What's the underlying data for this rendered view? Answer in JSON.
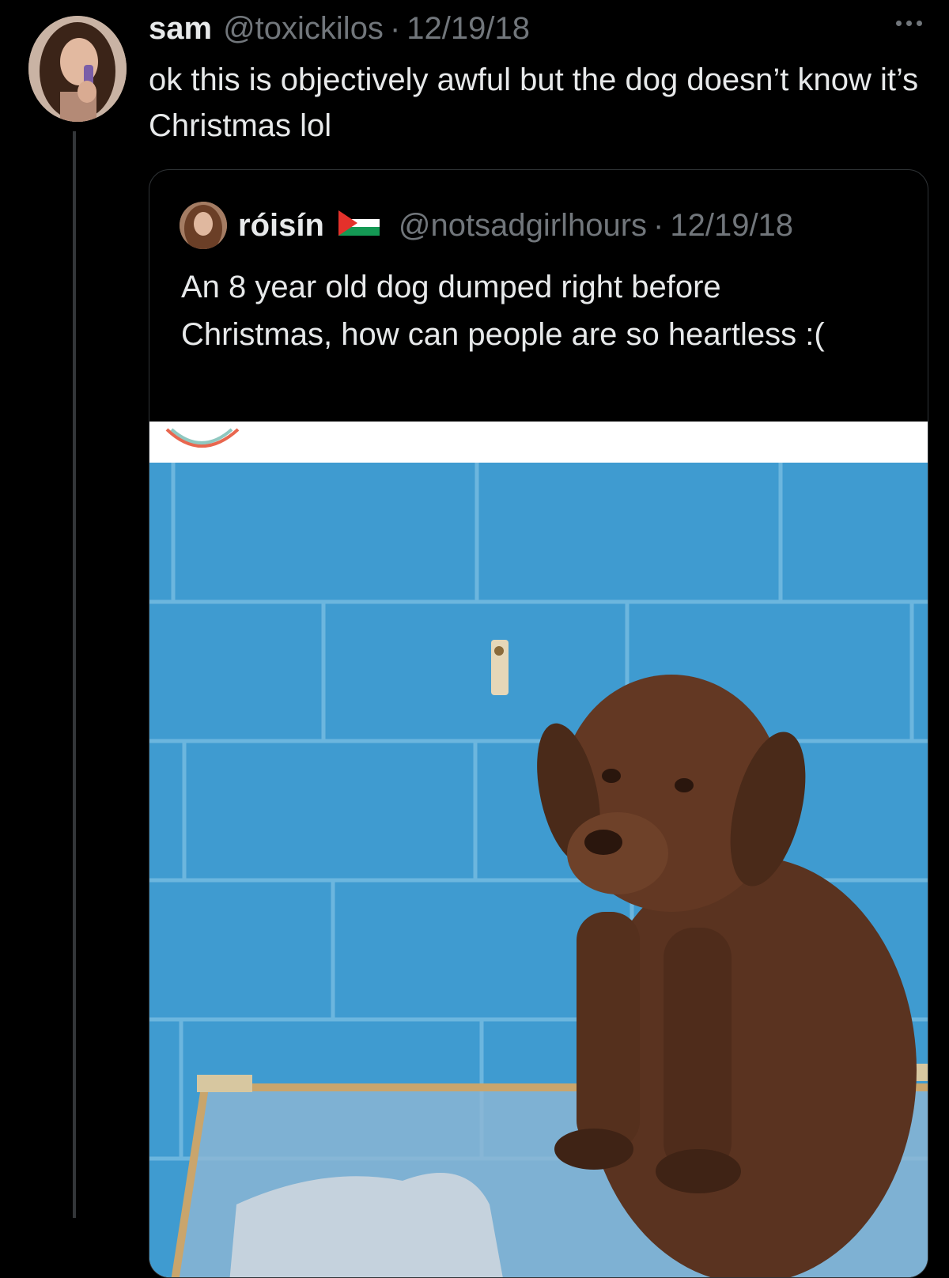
{
  "tweet": {
    "display_name": "sam",
    "handle": "@toxickilos",
    "separator": "·",
    "date": "12/19/18",
    "text": "ok this is objectively awful but the dog doesn’t know it’s Christmas lol",
    "more_icon": "more-horizontal-icon"
  },
  "quoted_tweet": {
    "display_name": "róisín",
    "flag_icon": "palestine-flag-icon",
    "handle": "@notsadgirlhours",
    "separator": "·",
    "date": "12/19/18",
    "text": "An 8 year old dog dumped right before Christmas, how can people are so heartless :("
  },
  "colors": {
    "background": "#000000",
    "primary_text": "#e7e9ea",
    "secondary_text": "#71767b",
    "border": "#2f3336",
    "kennel_wall": "#3f9bd0",
    "dog": "#5a3320"
  }
}
